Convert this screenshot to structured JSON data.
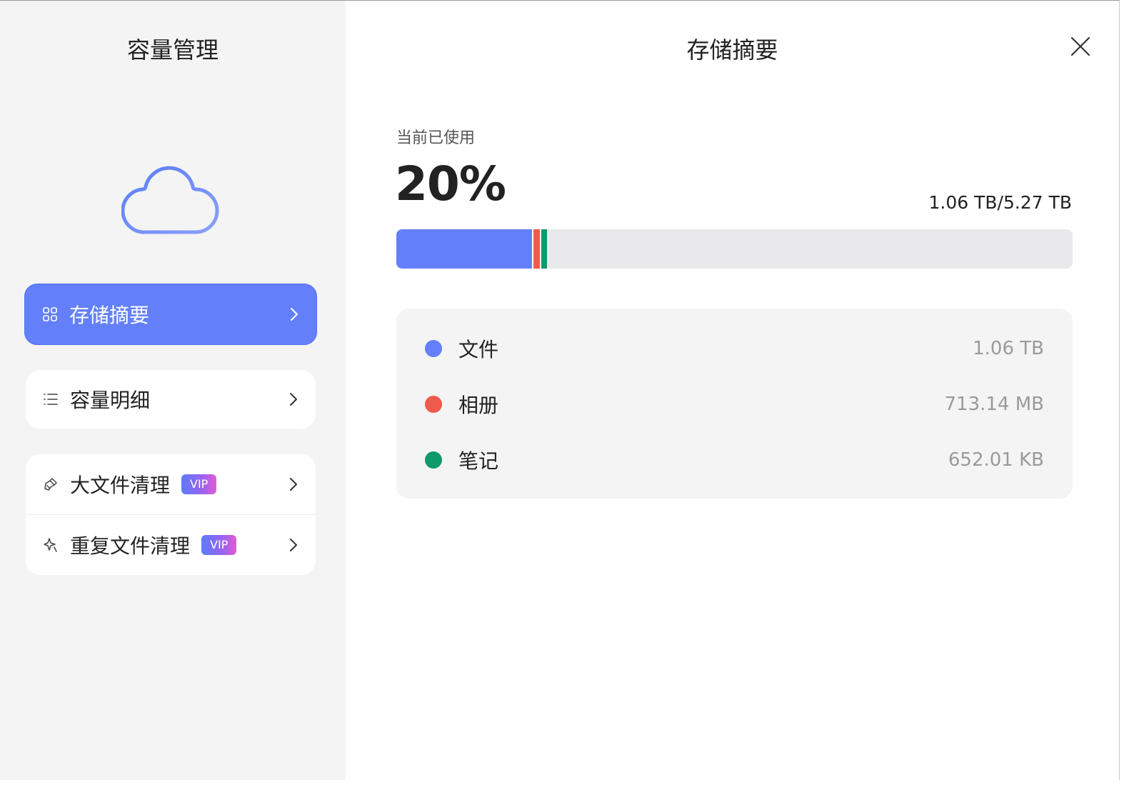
{
  "sidebar": {
    "title": "容量管理",
    "items": [
      {
        "label": "存储摘要",
        "icon": "grid-icon",
        "active": true
      },
      {
        "label": "容量明细",
        "icon": "list-icon",
        "active": false
      },
      {
        "label": "大文件清理",
        "icon": "broom-icon",
        "badge": "VIP",
        "active": false
      },
      {
        "label": "重复文件清理",
        "icon": "sparkle-icon",
        "badge": "VIP",
        "active": false
      }
    ]
  },
  "main": {
    "title": "存储摘要",
    "usage": {
      "caption": "当前已使用",
      "percent": "20%",
      "amount": "1.06 TB/5.27 TB"
    },
    "categories": [
      {
        "name": "文件",
        "value": "1.06 TB",
        "color": "#6380fa",
        "bar_fraction": 0.201
      },
      {
        "name": "相册",
        "value": "713.14 MB",
        "color": "#f05a4a",
        "bar_fraction": 0.011
      },
      {
        "name": "笔记",
        "value": "652.01 KB",
        "color": "#0e9a6a",
        "bar_fraction": 0.011
      }
    ]
  },
  "colors": {
    "accent": "#6380fa",
    "sidebar_bg": "#f4f4f4",
    "bar_track": "#e9e9eb"
  }
}
